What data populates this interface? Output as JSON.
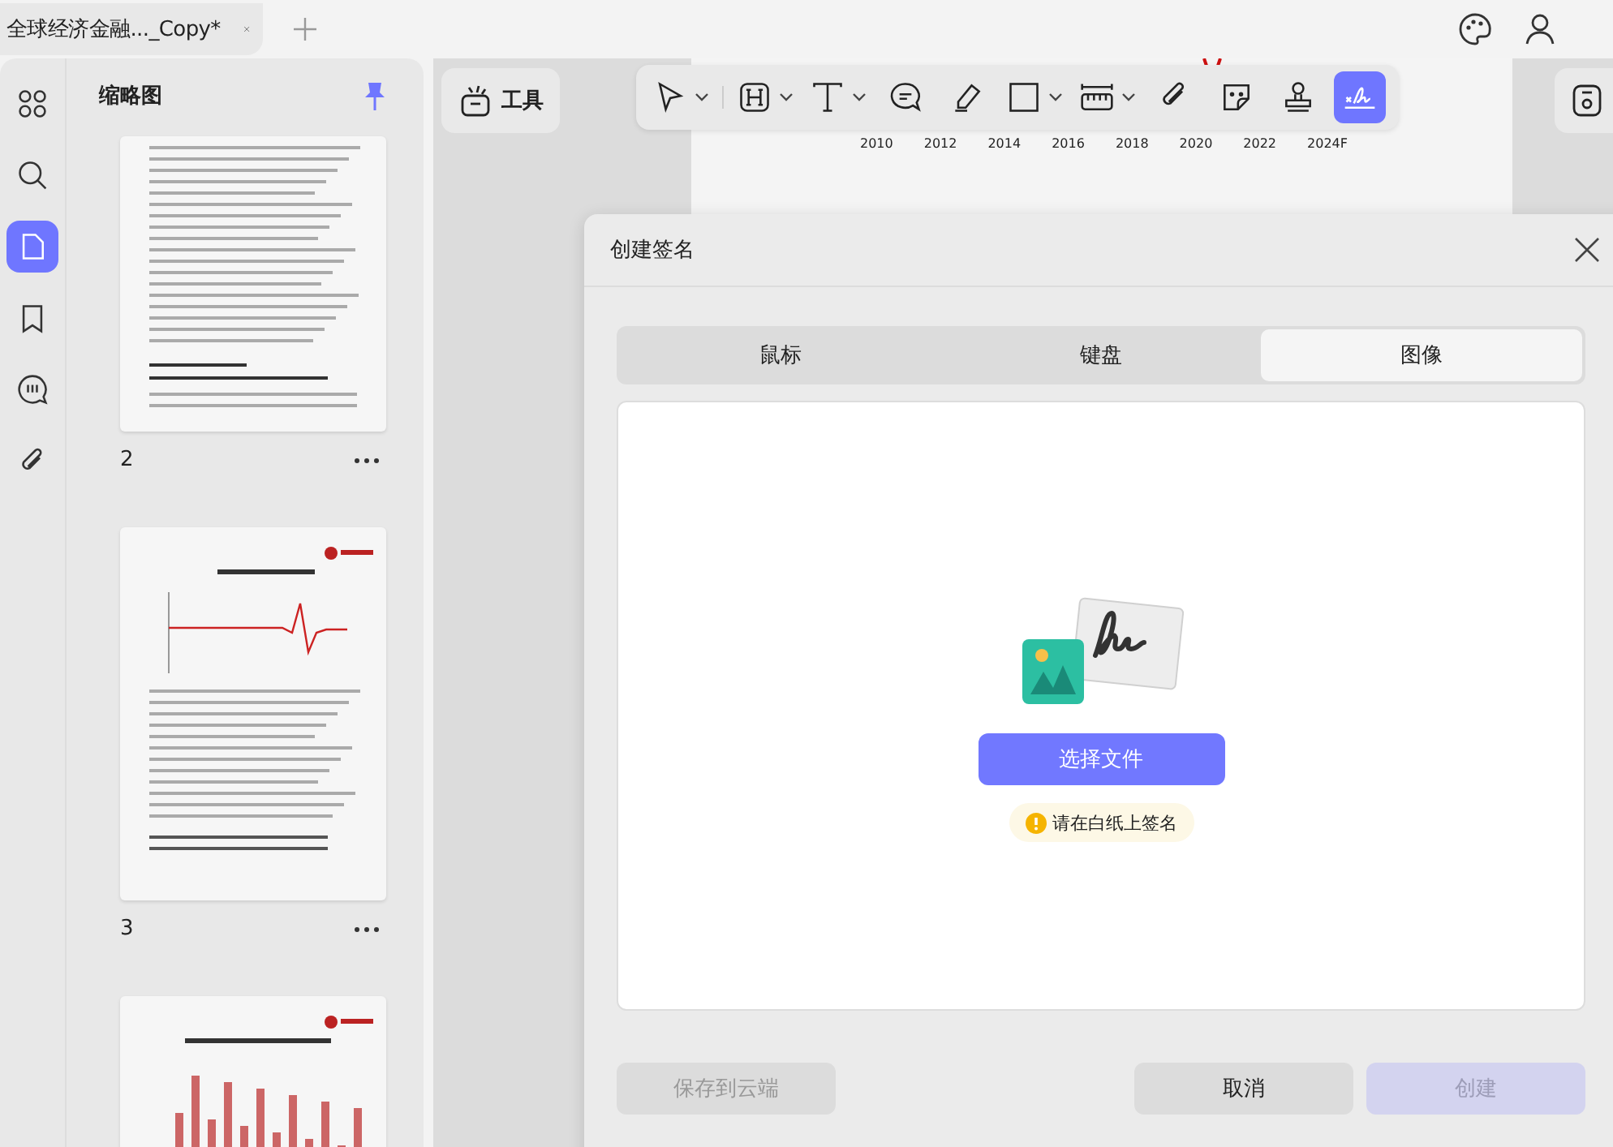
{
  "tab": {
    "title": "全球经济金融..._Copy*"
  },
  "rail": [
    {
      "kind": "grid",
      "selected": false
    },
    {
      "kind": "search",
      "selected": false
    },
    {
      "kind": "page",
      "selected": true
    },
    {
      "kind": "bookmark",
      "selected": false
    },
    {
      "kind": "comment",
      "selected": false
    },
    {
      "kind": "attachment",
      "selected": false
    }
  ],
  "sidebar": {
    "title": "缩略图",
    "thumbnails": [
      {
        "kind": "text",
        "page": "2"
      },
      {
        "kind": "chart",
        "page": "3"
      },
      {
        "kind": "bars"
      }
    ]
  },
  "tools_button": "工具",
  "toolbar": [
    {
      "kind": "select",
      "dropdown": true,
      "selected": false
    },
    {
      "kind": "heading",
      "dropdown": true,
      "selected": false
    },
    {
      "kind": "text",
      "dropdown": true,
      "selected": false
    },
    {
      "kind": "comment",
      "dropdown": false,
      "selected": false
    },
    {
      "kind": "pen",
      "dropdown": false,
      "selected": false
    },
    {
      "kind": "shape",
      "dropdown": true,
      "selected": false
    },
    {
      "kind": "measure",
      "dropdown": true,
      "selected": false
    },
    {
      "kind": "attach",
      "dropdown": false,
      "selected": false
    },
    {
      "kind": "sticker",
      "dropdown": false,
      "selected": false
    },
    {
      "kind": "stamp",
      "dropdown": false,
      "selected": false
    },
    {
      "kind": "signature",
      "dropdown": false,
      "selected": true
    }
  ],
  "document": {
    "x_labels": [
      "2010",
      "2012",
      "2014",
      "2016",
      "2018",
      "2020",
      "2022",
      "2024F"
    ]
  },
  "dialog": {
    "title": "创建签名",
    "tabs": [
      {
        "label": "鼠标",
        "selected": false
      },
      {
        "label": "键盘",
        "selected": false
      },
      {
        "label": "图像",
        "selected": true
      }
    ],
    "upload_button": "选择文件",
    "hint": "请在白纸上签名",
    "buttons": [
      {
        "kind": "save",
        "label": "保存到云端",
        "disabled": true
      },
      {
        "kind": "cancel",
        "label": "取消",
        "disabled": false
      },
      {
        "kind": "create",
        "label": "创建",
        "disabled": true
      }
    ]
  }
}
